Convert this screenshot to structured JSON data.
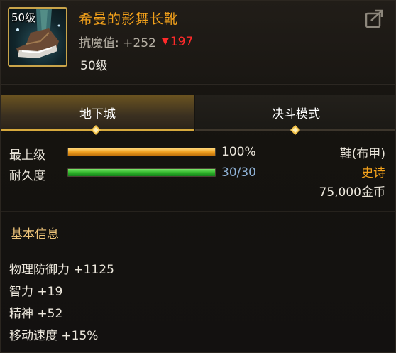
{
  "item": {
    "icon_level": "50级",
    "name": "希曼的影舞长靴",
    "resist_label": "抗魔值: +252",
    "resist_drop": "197",
    "level": "50级"
  },
  "tabs": [
    {
      "label": "地下城",
      "active": true
    },
    {
      "label": "决斗模式",
      "active": false
    }
  ],
  "stats": {
    "max_level": {
      "label": "最上级",
      "value_text": "100%",
      "fraction": 1.0
    },
    "durability": {
      "label": "耐久度",
      "value_text": "30/30",
      "fraction": 1.0
    }
  },
  "info": {
    "type": "鞋(布甲)",
    "rarity": "史诗",
    "price": "75,000金币"
  },
  "basic": {
    "title": "基本信息",
    "attributes": [
      "物理防御力 +1125",
      "智力 +19",
      "精神 +52",
      "移动速度 +15%"
    ]
  },
  "colors": {
    "name": "#f4a21b",
    "rarity": "#f4a21b",
    "resist_drop": "#ff2a2a",
    "durability_text": "#8fb2d6",
    "tab_accent": "#d6a93d"
  },
  "icons": {
    "item": "boot-icon",
    "share": "share-icon",
    "resist_down": "down-triangle-icon",
    "tab_marker": "diamond-icon"
  }
}
